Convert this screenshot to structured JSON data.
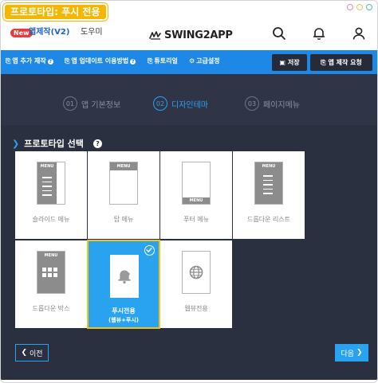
{
  "window": {
    "title": "프로토타입: 푸시 전용"
  },
  "topnav": {
    "new_badge": "New",
    "app_make": "앱제작(V2)",
    "help": "도우미",
    "logo_text": "SWING2APP",
    "icons": [
      "search-icon",
      "bell-icon",
      "user-icon"
    ]
  },
  "toolbar": {
    "items": [
      {
        "label": "앱 추가 제작",
        "help": "?"
      },
      {
        "label": "앱 업데이트 이용방법",
        "help": "?"
      },
      {
        "label": "튜토리얼"
      },
      {
        "label": "고급설정"
      }
    ],
    "save_label": "저장",
    "request_label": "앱 제작 요청"
  },
  "steps": [
    {
      "num": "01",
      "label": "앱 기본정보",
      "active": false
    },
    {
      "num": "02",
      "label": "디자인테마",
      "active": true
    },
    {
      "num": "03",
      "label": "페이지메뉴",
      "active": false
    }
  ],
  "section": {
    "title": "프로토타입 선택",
    "help": "?"
  },
  "prototypes": [
    {
      "label": "슬라이드 메뉴",
      "menu_tag": "MENU"
    },
    {
      "label": "탑 메뉴",
      "menu_tag": "MENU"
    },
    {
      "label": "푸터 메뉴",
      "menu_tag": "MENU"
    },
    {
      "label": "드롭다운 리스트",
      "menu_tag": "MENU"
    },
    {
      "label": "드롭다운 박스",
      "menu_tag": "MENU"
    },
    {
      "label": "푸시전용",
      "sublabel": "(웹뷰+푸시)",
      "selected": true
    },
    {
      "label": "웹뷰전용"
    }
  ],
  "nav": {
    "prev_label": "이전",
    "next_label": "다음"
  },
  "colors": {
    "accent_blue": "#1d88e5",
    "selected_blue": "#29a3f0",
    "title_tag_yellow": "#f6b600",
    "dark_bg": "#2a3040",
    "new_badge_red": "#e63c3c"
  }
}
